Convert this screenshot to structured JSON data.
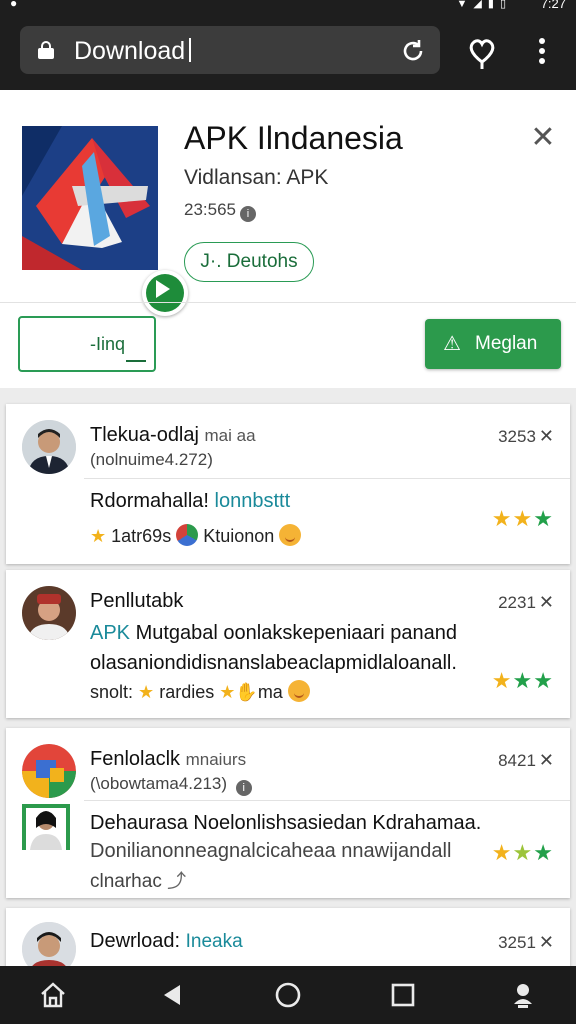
{
  "status": {
    "time": "7:27"
  },
  "browser": {
    "url_text": "Download"
  },
  "app": {
    "title": "APK Ilndanesia",
    "developer": "Vidlansan: APK",
    "size": "23:565",
    "pill_label": "J·. Deutohs",
    "left_button_label": "-Iinq",
    "install_label": "Meglan",
    "colors": {
      "accent": "#2c9a4c",
      "icon_bg": "#1f4d9a"
    }
  },
  "cards": [
    {
      "name": "Tlekua-odlaj",
      "name_suffix": "mai aa",
      "meta": "(nolnuime4.272)",
      "count": "3253",
      "line1_a": "Rdormahalla!",
      "line1_b": "lonnbsttt",
      "line2_a": "1atr69s",
      "line2_b": "Ktuionon"
    },
    {
      "name": "Penllutabk",
      "count": "2231",
      "line1_a": "APK",
      "line1_b": "Mutgabal oonlakskepeniaari panand",
      "line2": "olasaniondidisnanslabeaclapmidlaloanall.",
      "line3_a": "snolt:",
      "line3_b": "rardies",
      "line3_c": "ma"
    },
    {
      "name": "Fenlolaclk",
      "name_suffix": "mnaiurs",
      "meta": "(\\obowtama4.213)",
      "count": "8421",
      "line1": "Dehaurasa Noelonlishsasiedan Kdrahamaa.",
      "line2": "Donilianonneagnalcicaheaa nnawijandall",
      "line3": "clnarhac"
    },
    {
      "name": "Dewrload:",
      "name_suffix": "Ineaka",
      "count": "3251"
    }
  ],
  "icons": [
    "lock-icon",
    "reload-icon",
    "heart-icon",
    "more-icon",
    "close-icon",
    "info-icon",
    "play-icon",
    "star-icon",
    "home-icon",
    "back-icon",
    "circle-icon",
    "square-icon",
    "account-icon"
  ]
}
